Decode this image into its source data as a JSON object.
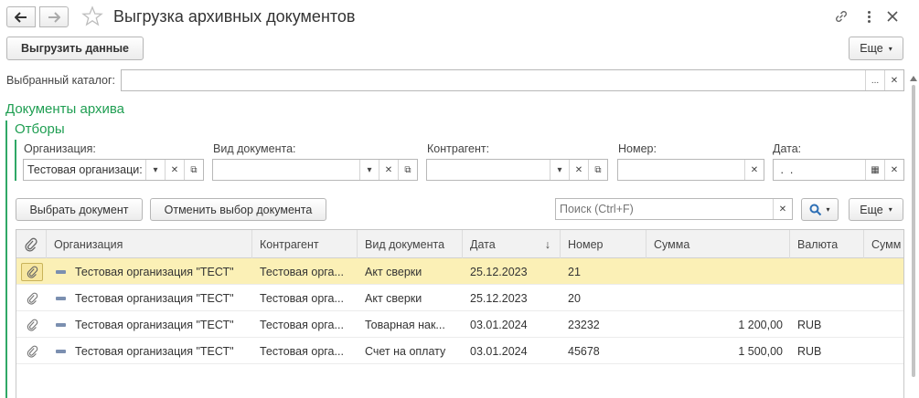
{
  "window": {
    "title": "Выгрузка архивных документов"
  },
  "toolbar": {
    "unload_label": "Выгрузить данные",
    "more_label": "Еще"
  },
  "catalog": {
    "label": "Выбранный каталог:",
    "value": ""
  },
  "archive_section": {
    "title": "Документы архива",
    "filters_title": "Отборы"
  },
  "filters": {
    "organization": {
      "label": "Организация:",
      "value": "Тестовая организаци:"
    },
    "doc_type": {
      "label": "Вид документа:",
      "value": ""
    },
    "counterparty": {
      "label": "Контрагент:",
      "value": ""
    },
    "number": {
      "label": "Номер:",
      "value": ""
    },
    "date": {
      "label": "Дата:",
      "value": " .  ."
    }
  },
  "list_toolbar": {
    "select_doc": "Выбрать документ",
    "cancel_select": "Отменить выбор документа",
    "search_placeholder": "Поиск (Ctrl+F)",
    "more_label": "Еще"
  },
  "table": {
    "columns": [
      "Организация",
      "Контрагент",
      "Вид документа",
      "Дата",
      "Номер",
      "Сумма",
      "Валюта",
      "Сумм"
    ],
    "sort_indicator": "↓",
    "rows": [
      {
        "org": "Тестовая организация \"ТЕСТ\"",
        "counterparty": "Тестовая орга...",
        "doc_type": "Акт сверки",
        "date": "25.12.2023",
        "number": "21",
        "sum": "",
        "currency": ""
      },
      {
        "org": "Тестовая организация \"ТЕСТ\"",
        "counterparty": "Тестовая орга...",
        "doc_type": "Акт сверки",
        "date": "25.12.2023",
        "number": "20",
        "sum": "",
        "currency": ""
      },
      {
        "org": "Тестовая организация \"ТЕСТ\"",
        "counterparty": "Тестовая орга...",
        "doc_type": "Товарная нак...",
        "date": "03.01.2024",
        "number": "23232",
        "sum": "1 200,00",
        "currency": "RUB"
      },
      {
        "org": "Тестовая организация \"ТЕСТ\"",
        "counterparty": "Тестовая орга...",
        "doc_type": "Счет на оплату",
        "date": "03.01.2024",
        "number": "45678",
        "sum": "1 500,00",
        "currency": "RUB"
      }
    ]
  },
  "colors": {
    "accent_green": "#1f9e52",
    "selected_row": "#fbf0b6"
  }
}
